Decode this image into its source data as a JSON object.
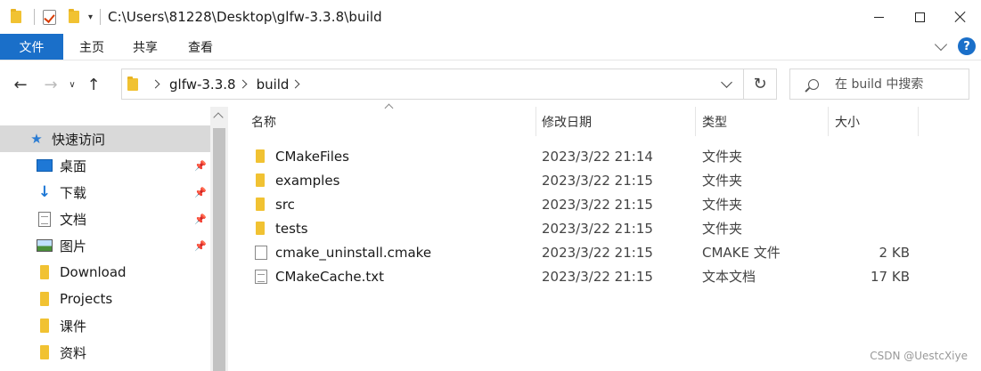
{
  "window": {
    "title_path": "C:\\Users\\81228\\Desktop\\glfw-3.3.8\\build",
    "quick_access_dropdown": "▾"
  },
  "ribbon": {
    "tabs": [
      {
        "label": "文件"
      },
      {
        "label": "主页"
      },
      {
        "label": "共享"
      },
      {
        "label": "查看"
      }
    ],
    "help_label": "?"
  },
  "address": {
    "crumbs": [
      "glfw-3.3.8",
      "build"
    ]
  },
  "search": {
    "placeholder": "在 build 中搜索"
  },
  "nav_pane": {
    "items": [
      {
        "label": "快速访问",
        "icon": "star-icon",
        "pinned": false,
        "active": true
      },
      {
        "label": "桌面",
        "icon": "desktop-icon",
        "pinned": true
      },
      {
        "label": "下载",
        "icon": "download-icon",
        "pinned": true
      },
      {
        "label": "文档",
        "icon": "document-icon",
        "pinned": true
      },
      {
        "label": "图片",
        "icon": "pictures-icon",
        "pinned": true
      },
      {
        "label": "Download",
        "icon": "folder-icon",
        "pinned": false
      },
      {
        "label": "Projects",
        "icon": "folder-icon",
        "pinned": false
      },
      {
        "label": "课件",
        "icon": "folder-icon",
        "pinned": false
      },
      {
        "label": "资料",
        "icon": "folder-icon",
        "pinned": false
      }
    ]
  },
  "file_list": {
    "columns": [
      "名称",
      "修改日期",
      "类型",
      "大小"
    ],
    "rows": [
      {
        "name": "CMakeFiles",
        "date": "2023/3/22 21:14",
        "type": "文件夹",
        "size": "",
        "icon": "folder-icon"
      },
      {
        "name": "examples",
        "date": "2023/3/22 21:15",
        "type": "文件夹",
        "size": "",
        "icon": "folder-icon"
      },
      {
        "name": "src",
        "date": "2023/3/22 21:15",
        "type": "文件夹",
        "size": "",
        "icon": "folder-icon"
      },
      {
        "name": "tests",
        "date": "2023/3/22 21:15",
        "type": "文件夹",
        "size": "",
        "icon": "folder-icon"
      },
      {
        "name": "cmake_uninstall.cmake",
        "date": "2023/3/22 21:15",
        "type": "CMAKE 文件",
        "size": "2 KB",
        "icon": "file-icon"
      },
      {
        "name": "CMakeCache.txt",
        "date": "2023/3/22 21:15",
        "type": "文本文档",
        "size": "17 KB",
        "icon": "text-file-icon"
      }
    ]
  },
  "watermark": "CSDN @UestcXiye"
}
